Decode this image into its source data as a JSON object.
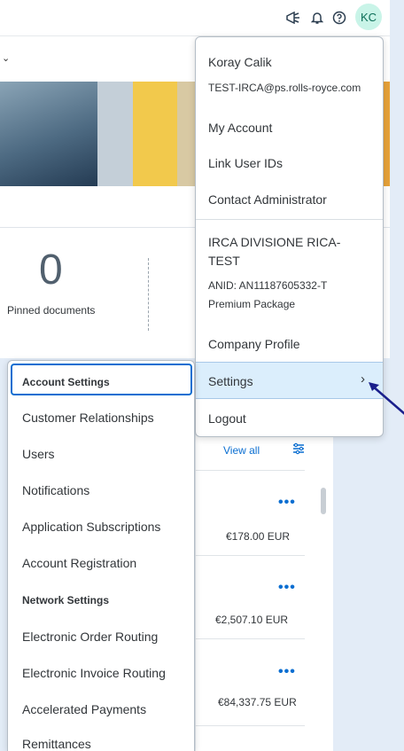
{
  "topbar": {
    "icons": [
      "megaphone-icon",
      "bell-icon",
      "help-icon"
    ],
    "avatar_initials": "KC"
  },
  "background": {
    "pinned_count": "0",
    "pinned_label": "Pinned documents",
    "view_all": "View all",
    "rows": [
      {
        "more": "•••",
        "amount": "€178.00 EUR"
      },
      {
        "more": "•••",
        "amount": "€2,507.10 EUR"
      },
      {
        "more": "•••",
        "amount": "€84,337.75 EUR"
      }
    ]
  },
  "user_menu": {
    "name": "Koray Calik",
    "email": "TEST-IRCA@ps.rolls-royce.com",
    "my_account": "My Account",
    "link_user_ids": "Link User IDs",
    "contact_admin": "Contact Administrator",
    "company_line1": "IRCA DIVISIONE RICA-",
    "company_line2": "TEST",
    "anid": "ANID: AN11187605332-T",
    "package": "Premium Package",
    "company_profile": "Company Profile",
    "settings": "Settings",
    "logout": "Logout"
  },
  "settings_menu": {
    "account_settings": "Account Settings",
    "customer_relationships": "Customer Relationships",
    "users": "Users",
    "notifications": "Notifications",
    "application_subscriptions": "Application Subscriptions",
    "account_registration": "Account Registration",
    "network_settings": "Network Settings",
    "electronic_order_routing": "Electronic Order Routing",
    "electronic_invoice_routing": "Electronic Invoice Routing",
    "accelerated_payments": "Accelerated Payments",
    "remittances": "Remittances"
  },
  "colors": {
    "accent": "#0a6ed1",
    "highlight": "#dbeefc",
    "avatar_bg": "#c9f4e8",
    "annotation_arrow": "#1a1f8c"
  }
}
